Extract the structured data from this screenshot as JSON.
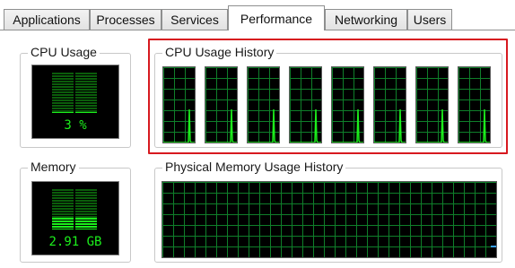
{
  "tabs": [
    {
      "label": "Applications",
      "active": false
    },
    {
      "label": "Processes",
      "active": false
    },
    {
      "label": "Services",
      "active": false
    },
    {
      "label": "Performance",
      "active": true
    },
    {
      "label": "Networking",
      "active": false
    },
    {
      "label": "Users",
      "active": false
    }
  ],
  "cpu_usage": {
    "label": "CPU Usage",
    "value": "3 %",
    "level_percent": 3
  },
  "memory": {
    "label": "Memory",
    "value": "2.91 GB",
    "level_percent": 28
  },
  "cpu_history": {
    "label": "CPU Usage History",
    "core_count": 8,
    "highlight_color": "#d7191f"
  },
  "memory_history": {
    "label": "Physical Memory Usage History"
  },
  "colors": {
    "graph_bg": "#000000",
    "grid": "#0f7f2a",
    "trace": "#1cf01c",
    "meter_dim": "#0b5d0b"
  }
}
